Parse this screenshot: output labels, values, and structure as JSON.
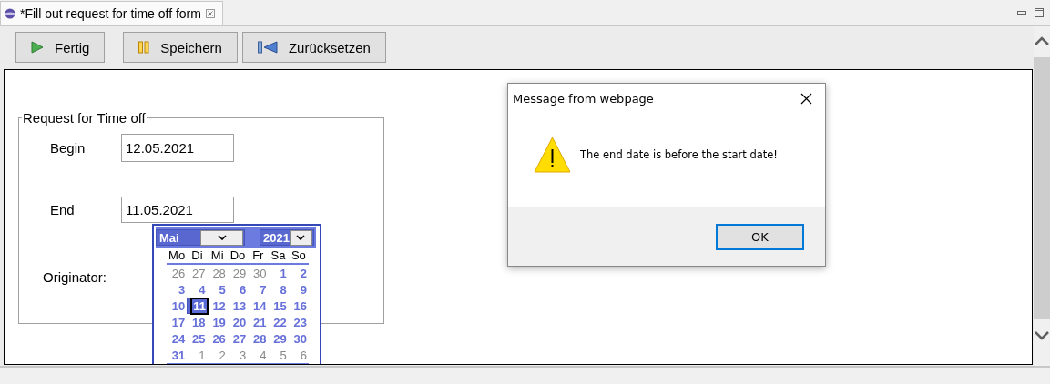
{
  "editor_tab": {
    "title": "*Fill out request for time off form"
  },
  "toolbar": {
    "buttons": [
      {
        "label": "Fertig",
        "kind": "play"
      },
      {
        "label": "Speichern",
        "kind": "pause"
      },
      {
        "label": "Zurücksetzen",
        "kind": "rewind"
      }
    ]
  },
  "form": {
    "legend": "Request for Time off",
    "fields": [
      {
        "label": "Begin",
        "value": "12.05.2021"
      },
      {
        "label": "End",
        "value": "11.05.2021"
      },
      {
        "label": "Originator:"
      }
    ]
  },
  "date_picker": {
    "month": "Mai",
    "year": "2021",
    "weekdays": [
      "Mo",
      "Di",
      "Mi",
      "Do",
      "Fr",
      "Sa",
      "So"
    ],
    "weeks": [
      [
        {
          "day": "26",
          "in_month": false,
          "selected": false
        },
        {
          "day": "27",
          "in_month": false,
          "selected": false
        },
        {
          "day": "28",
          "in_month": false,
          "selected": false
        },
        {
          "day": "29",
          "in_month": false,
          "selected": false
        },
        {
          "day": "30",
          "in_month": false,
          "selected": false
        },
        {
          "day": "1",
          "in_month": true,
          "selected": false
        },
        {
          "day": "2",
          "in_month": true,
          "selected": false
        }
      ],
      [
        {
          "day": "3",
          "in_month": true,
          "selected": false
        },
        {
          "day": "4",
          "in_month": true,
          "selected": false
        },
        {
          "day": "5",
          "in_month": true,
          "selected": false
        },
        {
          "day": "6",
          "in_month": true,
          "selected": false
        },
        {
          "day": "7",
          "in_month": true,
          "selected": false
        },
        {
          "day": "8",
          "in_month": true,
          "selected": false
        },
        {
          "day": "9",
          "in_month": true,
          "selected": false
        }
      ],
      [
        {
          "day": "10",
          "in_month": true,
          "selected": false
        },
        {
          "day": "11",
          "in_month": true,
          "selected": true
        },
        {
          "day": "12",
          "in_month": true,
          "selected": false
        },
        {
          "day": "13",
          "in_month": true,
          "selected": false
        },
        {
          "day": "14",
          "in_month": true,
          "selected": false
        },
        {
          "day": "15",
          "in_month": true,
          "selected": false
        },
        {
          "day": "16",
          "in_month": true,
          "selected": false
        }
      ],
      [
        {
          "day": "17",
          "in_month": true,
          "selected": false
        },
        {
          "day": "18",
          "in_month": true,
          "selected": false
        },
        {
          "day": "19",
          "in_month": true,
          "selected": false
        },
        {
          "day": "20",
          "in_month": true,
          "selected": false
        },
        {
          "day": "21",
          "in_month": true,
          "selected": false
        },
        {
          "day": "22",
          "in_month": true,
          "selected": false
        },
        {
          "day": "23",
          "in_month": true,
          "selected": false
        }
      ],
      [
        {
          "day": "24",
          "in_month": true,
          "selected": false
        },
        {
          "day": "25",
          "in_month": true,
          "selected": false
        },
        {
          "day": "26",
          "in_month": true,
          "selected": false
        },
        {
          "day": "27",
          "in_month": true,
          "selected": false
        },
        {
          "day": "28",
          "in_month": true,
          "selected": false
        },
        {
          "day": "29",
          "in_month": true,
          "selected": false
        },
        {
          "day": "30",
          "in_month": true,
          "selected": false
        }
      ],
      [
        {
          "day": "31",
          "in_month": true,
          "selected": false
        },
        {
          "day": "1",
          "in_month": false,
          "selected": false
        },
        {
          "day": "2",
          "in_month": false,
          "selected": false
        },
        {
          "day": "3",
          "in_month": false,
          "selected": false
        },
        {
          "day": "4",
          "in_month": false,
          "selected": false
        },
        {
          "day": "5",
          "in_month": false,
          "selected": false
        },
        {
          "day": "6",
          "in_month": false,
          "selected": false
        }
      ]
    ]
  },
  "dialog": {
    "title": "Message from webpage",
    "message": "The end date is before the start date!",
    "buttons": [
      {
        "label": "OK",
        "focused": true
      }
    ]
  }
}
